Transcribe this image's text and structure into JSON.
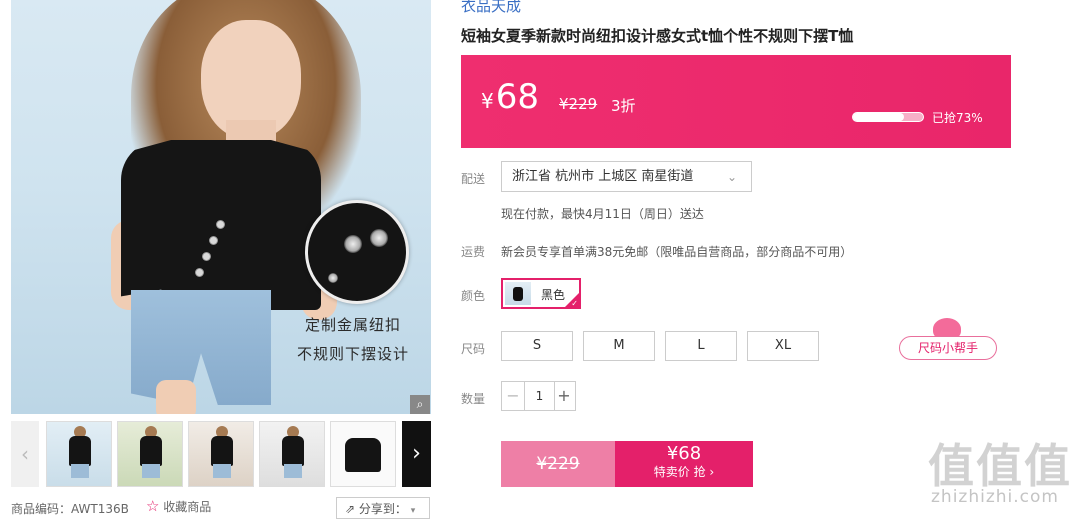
{
  "gallery": {
    "main_caption_1": "定制金属纽扣",
    "main_caption_2": "不规则下摆设计",
    "zoom_icon": "magnifier-icon",
    "prev_icon": "chevron-left-icon",
    "next_icon": "chevron-right-icon",
    "product_code": "商品编码：AWT136B",
    "favorite_label": "收藏商品",
    "share_label": "分享到："
  },
  "product": {
    "brand": "衣品天成",
    "title": "短袖女夏季新款时尚纽扣设计感女式t恤个性不规则下摆T恤"
  },
  "price": {
    "currency": "¥",
    "current": "68",
    "original": "¥229",
    "discount": "3折",
    "sold_percent": 73,
    "sold_text": "已抢73%"
  },
  "delivery": {
    "label": "配送",
    "address": "浙江省 杭州市 上城区 南星街道",
    "eta": "现在付款，最快4月11日（周日）送达"
  },
  "shipping": {
    "label": "运费",
    "text": "新会员专享首单满38元免邮（限唯品自营商品，部分商品不可用）"
  },
  "color": {
    "label": "颜色",
    "selected": "黑色"
  },
  "size": {
    "label": "尺码",
    "options": [
      "S",
      "M",
      "L",
      "XL"
    ],
    "helper": "尺码小帮手"
  },
  "quantity": {
    "label": "数量",
    "value": "1",
    "minus": "−",
    "plus": "+"
  },
  "buy": {
    "original": "¥229",
    "price": "¥68",
    "label": "特卖价 抢 ›"
  },
  "watermark": {
    "logo": "值值值",
    "url": "zhizhizhi.com"
  },
  "colors": {
    "accent": "#e4206a",
    "price_bar": "#ef2e6f",
    "link_blue": "#3a6fc4"
  }
}
